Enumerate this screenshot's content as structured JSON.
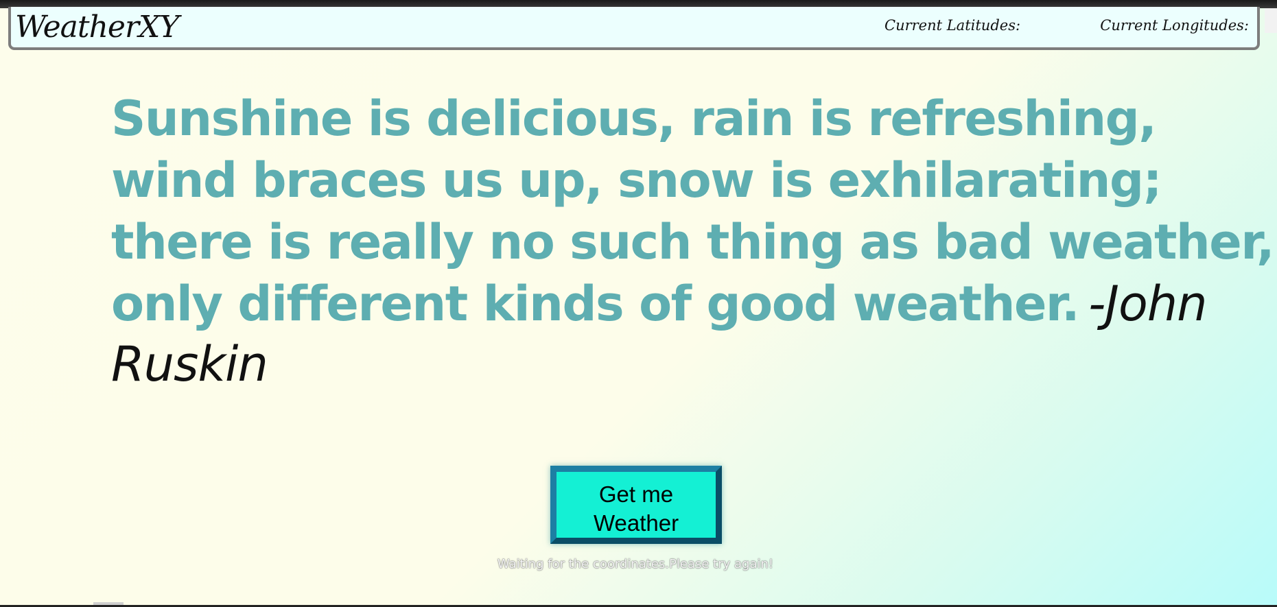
{
  "navbar": {
    "brand": "WeatherXY",
    "latitude_label": "Current Latitudes:",
    "latitude_value": "",
    "longitude_label": "Current Longitudes:",
    "longitude_value": ""
  },
  "quote": {
    "lines": [
      "Sunshine is delicious, rain is refreshing,",
      "wind braces us up, snow is exhilarating;",
      "there is really no such thing as bad weather,",
      "only different kinds of good weather."
    ],
    "author_part1": "-John",
    "author_part2": "Ruskin"
  },
  "action": {
    "button_line1": "Get me",
    "button_line2": "Weather"
  },
  "status": {
    "message": "Waiting for the coordinates.Please try again!"
  },
  "colors": {
    "quote_text": "#5eaeb1",
    "button_fill": "#14f0d4",
    "button_border": "#1d7fa3",
    "navbar_bg": "#ecfffe"
  }
}
